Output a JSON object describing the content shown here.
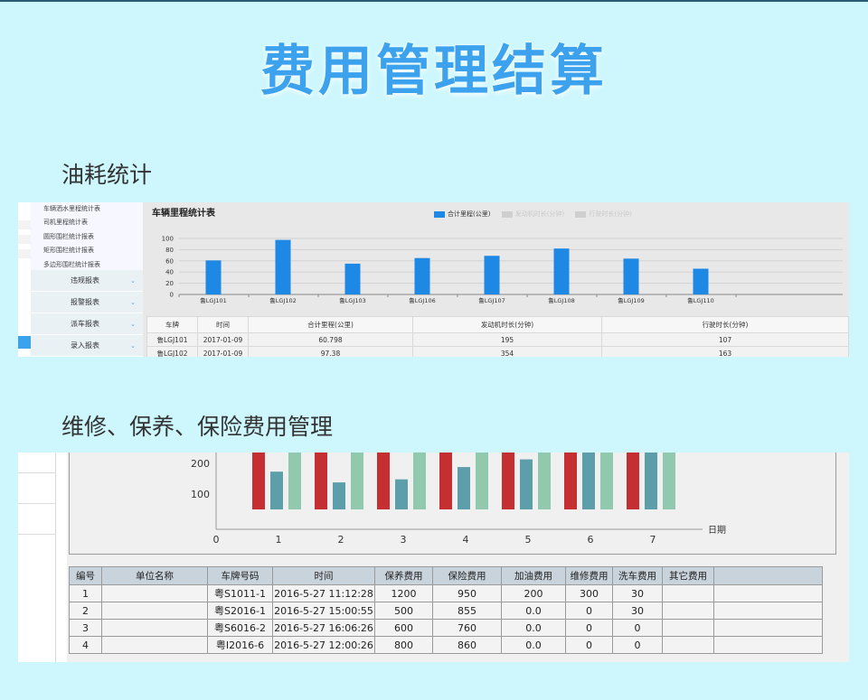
{
  "main_title": "费用管理结算",
  "section1_title": "油耗统计",
  "section2_title": "维修、保养、保险费用管理",
  "sidebar1": {
    "sub_items": [
      "车辆洒水里程统计表",
      "司机里程统计表",
      "圆形围栏统计报表",
      "矩形围栏统计报表",
      "多边形围栏统计报表"
    ],
    "groups": [
      "违规报表",
      "报警报表",
      "派车报表",
      "录入报表"
    ],
    "chevron": "⌄"
  },
  "chart1": {
    "title": "车辆里程统计表",
    "legend": [
      "合计里程(公里)",
      "发动机时长(分钟)",
      "行驶时长(分钟)"
    ],
    "colors": {
      "bar": "#1e88e5",
      "legend_off": "#cfcfcf"
    }
  },
  "chart1_data": {
    "type": "bar",
    "categories": [
      "鲁LGJ101",
      "鲁LGJ102",
      "鲁LGJ103",
      "鲁LGJ106",
      "鲁LGJ107",
      "鲁LGJ108",
      "鲁LGJ109",
      "鲁LGJ110"
    ],
    "values": [
      60.798,
      97.38,
      55,
      65,
      69,
      82,
      64,
      46
    ],
    "yticks": [
      0,
      20,
      40,
      60,
      80,
      100
    ],
    "ylim": [
      0,
      100
    ]
  },
  "table1": {
    "headers": [
      "车牌",
      "时间",
      "合计里程(公里)",
      "发动机时长(分钟)",
      "行驶时长(分钟)"
    ],
    "rows": [
      [
        "鲁LGJ101",
        "2017-01-09",
        "60.798",
        "195",
        "107"
      ],
      [
        "鲁LGJ102",
        "2017-01-09",
        "97.38",
        "354",
        "163"
      ]
    ]
  },
  "chart2_data": {
    "type": "bar",
    "x_ticks": [
      "0",
      "1",
      "2",
      "3",
      "4",
      "5",
      "6",
      "7"
    ],
    "y_ticks": [
      "200",
      "100"
    ],
    "xlabel": "日期",
    "ylim": [
      0,
      300
    ],
    "colors": [
      "#c62f32",
      "#5c9eaa",
      "#91c9ae"
    ],
    "series": [
      {
        "values": [
          300,
          300,
          260,
          300,
          300,
          300,
          260
        ]
      },
      {
        "values": [
          170,
          135,
          145,
          185,
          210,
          300,
          250
        ]
      },
      {
        "values": [
          300,
          300,
          300,
          300,
          300,
          300,
          300
        ]
      }
    ]
  },
  "table2": {
    "headers": [
      "编号",
      "单位名称",
      "车牌号码",
      "时间",
      "保养费用",
      "保险费用",
      "加油费用",
      "维修费用",
      "洗车费用",
      "其它费用"
    ],
    "rows": [
      [
        "1",
        "",
        "粤S1011-1",
        "2016-5-27 11:12:28",
        "1200",
        "950",
        "200",
        "300",
        "30",
        ""
      ],
      [
        "2",
        "",
        "粤S2016-1",
        "2016-5-27 15:00:55",
        "500",
        "855",
        "0.0",
        "0",
        "30",
        ""
      ],
      [
        "3",
        "",
        "粤S6016-2",
        "2016-5-27 16:06:26",
        "600",
        "760",
        "0.0",
        "0",
        "0",
        ""
      ],
      [
        "4",
        "",
        "粤I2016-6",
        "2016-5-27 12:00:26",
        "800",
        "860",
        "0.0",
        "0",
        "0",
        ""
      ]
    ]
  }
}
